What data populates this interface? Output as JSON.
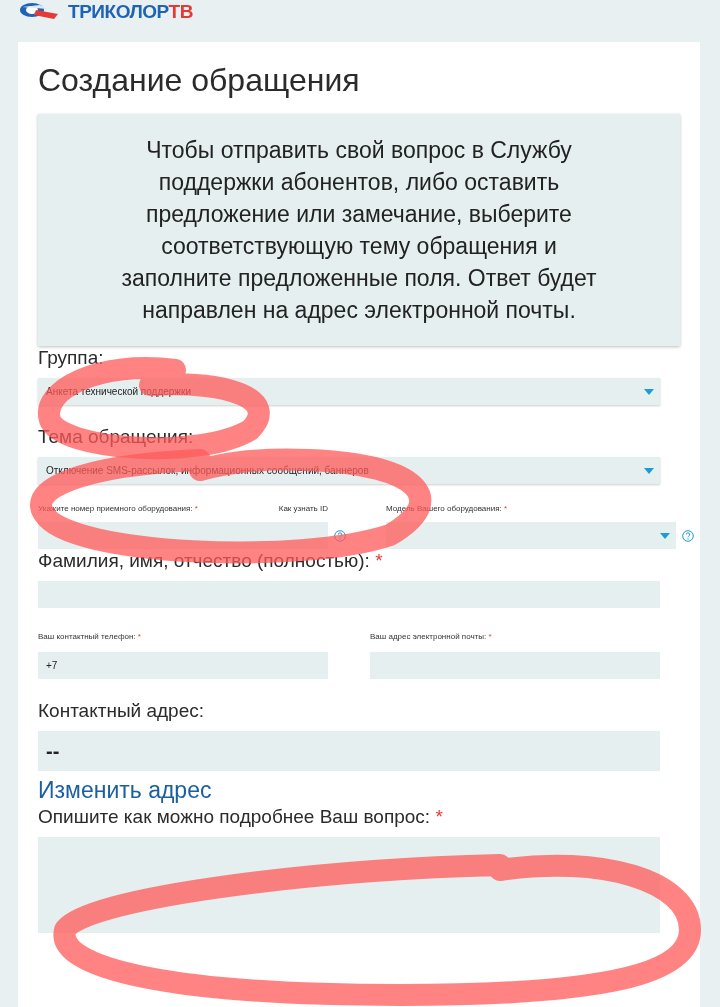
{
  "logo": {
    "text": "ТРИКОЛОР",
    "accent": "ТВ"
  },
  "title": "Создание обращения",
  "info": "Чтобы отправить свой вопрос в Службу поддержки абонентов, либо оставить предложение или замечание, выберите соответствующую тему обращения и заполните предложенные поля. Ответ будет направлен на адрес электронной почты.",
  "group": {
    "label": "Группа:",
    "value": "Анкета технической поддержки"
  },
  "topic": {
    "label": "Тема обращения:",
    "value": "Отключение SMS-рассылок, информационных сообщений, баннеров"
  },
  "receiver": {
    "label": "Укажите номер приемного оборудования:",
    "required_mark": "*",
    "link": "Как узнать ID"
  },
  "model": {
    "label": "Модель Вашего оборудования:",
    "required_mark": "*"
  },
  "full_name": {
    "label": "Фамилия, имя, отчество (полностью):",
    "required_mark": "*"
  },
  "phone": {
    "label": "Ваш контактный телефон:",
    "required_mark": "*",
    "value": "+7"
  },
  "email": {
    "label": "Ваш адрес электронной почты:",
    "required_mark": "*"
  },
  "address": {
    "label": "Контактный адрес:",
    "value": "--",
    "link": "Изменить адрес"
  },
  "question": {
    "label": "Опишите как можно подробнее Ваш вопрос:",
    "required_mark": "*"
  }
}
